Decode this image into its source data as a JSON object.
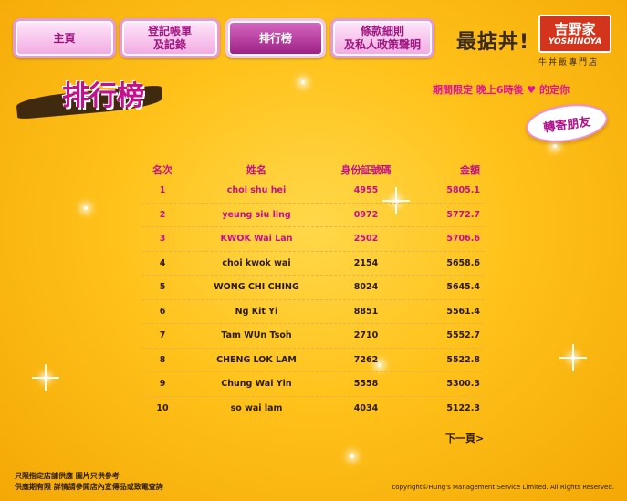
{
  "nav": {
    "home": "主頁",
    "register": "登記帳單\n及記錄",
    "ranking": "排行榜",
    "terms": "條款細則\n及私人政策聲明"
  },
  "brand": {
    "slogan": "最掂丼!",
    "logo_cn": "吉野家",
    "logo_en": "YOSHINOYA",
    "tagline": "牛丼飯專門店"
  },
  "page_title": "排行榜",
  "promo_text": "期間限定 晚上6時後 ♥ 的定你",
  "share_label": "轉寄朋友",
  "table": {
    "headers": [
      "名次",
      "姓名",
      "身份証號碼",
      "金額"
    ],
    "rows": [
      {
        "rank": "1",
        "name": "choi shu hei",
        "id": "4955",
        "amount": "5805.1"
      },
      {
        "rank": "2",
        "name": "yeung siu ling",
        "id": "0972",
        "amount": "5772.7"
      },
      {
        "rank": "3",
        "name": "KWOK Wai Lan",
        "id": "2502",
        "amount": "5706.6"
      },
      {
        "rank": "4",
        "name": "choi kwok wai",
        "id": "2154",
        "amount": "5658.6"
      },
      {
        "rank": "5",
        "name": "WONG CHI CHING",
        "id": "8024",
        "amount": "5645.4"
      },
      {
        "rank": "6",
        "name": "Ng Kit Yi",
        "id": "8851",
        "amount": "5561.4"
      },
      {
        "rank": "7",
        "name": "Tam WUn Tsoh",
        "id": "2710",
        "amount": "5552.7"
      },
      {
        "rank": "8",
        "name": "CHENG LOK LAM",
        "id": "7262",
        "amount": "5522.8"
      },
      {
        "rank": "9",
        "name": "Chung Wai Yin",
        "id": "5558",
        "amount": "5300.3"
      },
      {
        "rank": "10",
        "name": "so wai lam",
        "id": "4034",
        "amount": "5122.3"
      }
    ]
  },
  "next_label": "下一頁>",
  "footer": {
    "line1": "只限指定店舖供應  圖片只供參考",
    "line2": "供應期有限  詳情請參閱店內宣傳品或致電查詢",
    "copyright": "copyright©Hung's Management Service Limited. All Rights Reserved."
  },
  "colors": {
    "accent": "#c4108c",
    "background": "#ffc21a"
  }
}
